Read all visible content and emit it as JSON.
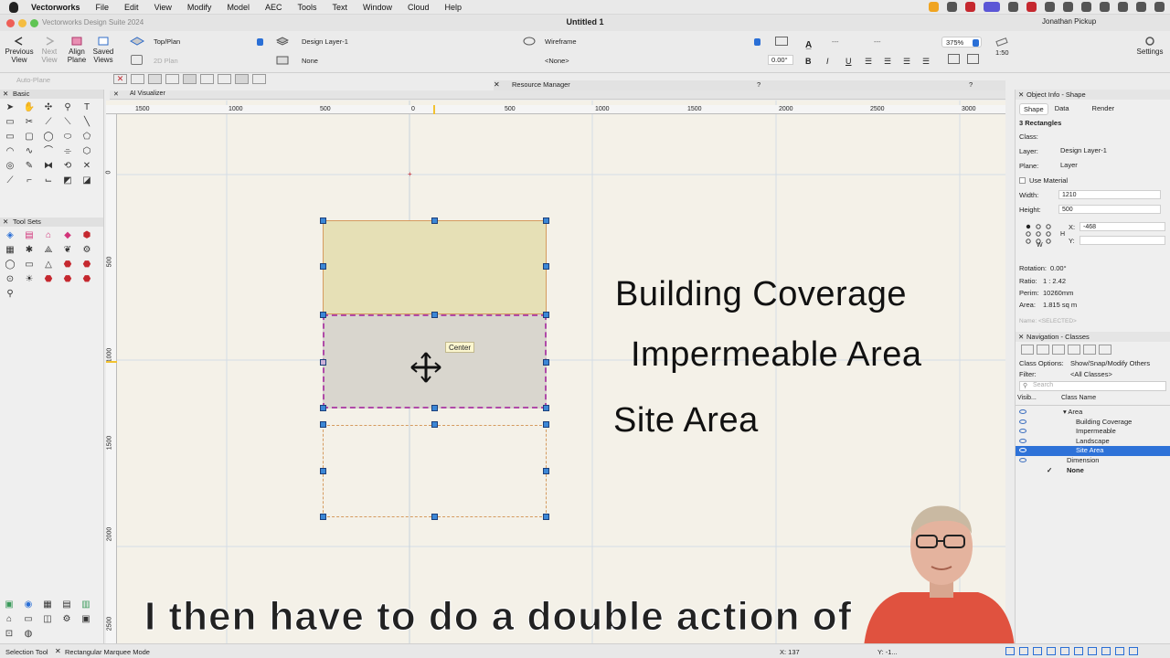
{
  "menubar": {
    "app": "Vectorworks",
    "items": [
      "File",
      "Edit",
      "View",
      "Modify",
      "Model",
      "AEC",
      "Tools",
      "Text",
      "Window",
      "Cloud",
      "Help"
    ],
    "user": "Jonathan Pickup"
  },
  "window": {
    "subtitle_left": "Vectorworks Design Suite 2024",
    "title": "Untitled 1"
  },
  "toolbar": {
    "previous_view": "Previous View",
    "next_view": "Next View",
    "align_plane": "Align Plane",
    "saved_views": "Saved Views",
    "auto_plane": "Auto-Plane",
    "view_select": "Top/Plan",
    "plane_select": "2D Plan",
    "layer_select": "Design Layer-1",
    "class_select": "None",
    "render_select": "Wireframe",
    "render_sub": "<None>",
    "angle": "0.00°",
    "zoom": "375%",
    "scale": "1:50",
    "settings": "Settings",
    "bold": "B",
    "italic": "I",
    "underline": "U"
  },
  "panels": {
    "resource_manager": "Resource Manager",
    "ai_visualizer": "AI Visualizer",
    "basic": "Basic",
    "tool_sets": "Tool Sets"
  },
  "rulers": {
    "top": [
      "1500",
      "1000",
      "500",
      "0",
      "500",
      "1000",
      "1500",
      "2000",
      "2500",
      "3000"
    ],
    "left": [
      "0",
      "500",
      "1000",
      "1500",
      "2000",
      "2500"
    ]
  },
  "canvas": {
    "labels": [
      "Building Coverage",
      "Impermeable Area",
      "Site Area"
    ],
    "tooltip": "Center",
    "subtitle": "I then have to do a double action of",
    "colors": {
      "building_fill": "#e6e0b6",
      "impermeable_fill": "#d9d6ce",
      "selection_outline": "#b04aa8",
      "rect_outline": "#d59a5e"
    }
  },
  "object_info": {
    "title": "Object Info - Shape",
    "tabs": [
      "Shape",
      "Data",
      "Render"
    ],
    "kind": "3 Rectangles",
    "class_label": "Class:",
    "class_value": "",
    "layer_label": "Layer:",
    "layer_value": "Design Layer-1",
    "plane_label": "Plane:",
    "plane_value": "Layer",
    "use_material": "Use Material",
    "width_label": "Width:",
    "width_value": "1210",
    "height_label": "Height:",
    "height_value": "500",
    "x_label": "X:",
    "x_value": "-468",
    "y_label": "Y:",
    "y_value": "",
    "h_label": "H",
    "w_label": "W",
    "rotation_label": "Rotation:",
    "rotation_value": "0.00°",
    "ratio_label": "Ratio:",
    "ratio_value": "1 : 2.42",
    "perim_label": "Perim:",
    "perim_value": "10260mm",
    "area_label": "Area:",
    "area_value": "1.815 sq m",
    "name_placeholder": "Name: <SELECTED>"
  },
  "navigation": {
    "title": "Navigation - Classes",
    "class_options_label": "Class Options:",
    "class_options_value": "Show/Snap/Modify Others",
    "filter_label": "Filter:",
    "filter_value": "<All Classes>",
    "search_placeholder": "Search",
    "col_visibility": "Visib...",
    "col_class_name": "Class Name",
    "classes": [
      "▾ Area",
      "Building Coverage",
      "Impermeable",
      "Landscape",
      "Site Area",
      "Dimension",
      "None"
    ]
  },
  "status": {
    "tool": "Selection Tool",
    "mode": "Rectangular Marquee Mode",
    "x": "X: 137",
    "y": "Y: -1..."
  }
}
